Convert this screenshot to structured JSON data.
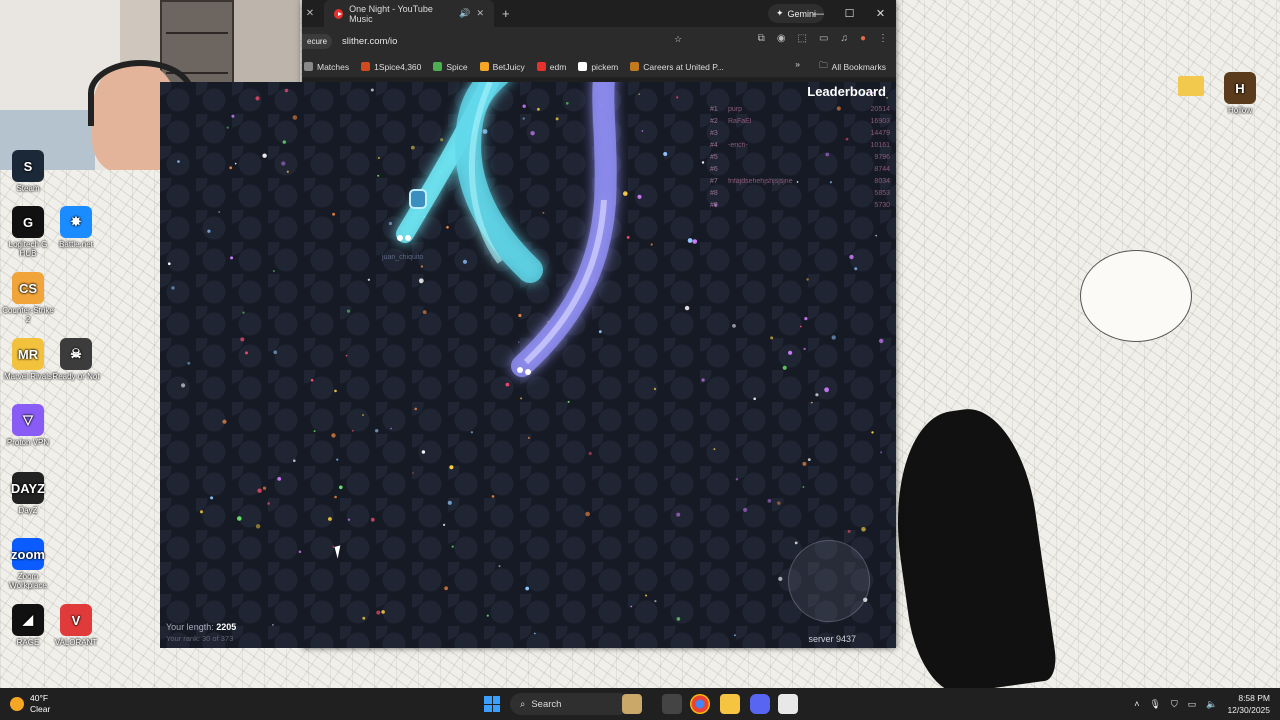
{
  "webcam": {
    "label": ""
  },
  "desktop": {
    "icons": [
      {
        "label": "Logitech G HUB",
        "glyph": "G",
        "color": "#111111"
      },
      {
        "label": "Battle.net",
        "glyph": "✸",
        "color": "#1a8cff"
      },
      {
        "label": "Counter-Strike 2",
        "glyph": "CS",
        "color": "#f0a43a"
      },
      {
        "label": "Marvel Rivals",
        "glyph": "MR",
        "color": "#f3c23c"
      },
      {
        "label": "Ready or Not",
        "glyph": "☠",
        "color": "#3c3c3c"
      },
      {
        "label": "Proton VPN",
        "glyph": "▽",
        "color": "#8a5cf6"
      },
      {
        "label": "DayZ",
        "glyph": "DAYZ",
        "color": "#222222"
      },
      {
        "label": "Zoom Workplace",
        "glyph": "zoom",
        "color": "#0b5cff"
      },
      {
        "label": "RAGE",
        "glyph": "◢",
        "color": "#111111"
      },
      {
        "label": "VALORANT",
        "glyph": "V",
        "color": "#e03a3a"
      },
      {
        "label": "Steam",
        "glyph": "S",
        "color": "#1b2838"
      },
      {
        "label": "Hollow",
        "glyph": "H",
        "color": "#5a3b1c"
      }
    ]
  },
  "browser": {
    "tab_title": "One Night - YouTube Music",
    "new_tab": "+",
    "gemini_label": "Gemini",
    "window_controls": {
      "minimize": "—",
      "maximize": "☐",
      "close": "✕"
    },
    "secure_label": "ecure",
    "url": "slither.com/io",
    "bookmarks": [
      {
        "label": "Matches",
        "color": "#888888"
      },
      {
        "label": "1Spice4,360",
        "color": "#d14a1d"
      },
      {
        "label": "Spice",
        "color": "#4caf50"
      },
      {
        "label": "BetJuicy",
        "color": "#f5a623"
      },
      {
        "label": "edm",
        "color": "#e5322d"
      },
      {
        "label": "pickem",
        "color": "#ffffff"
      },
      {
        "label": "Careers at United P...",
        "color": "#c27a1e"
      }
    ],
    "bookmarks_overflow": "»",
    "all_bookmarks": "All Bookmarks"
  },
  "game": {
    "leaderboard_title": "Leaderboard",
    "leaderboard": [
      {
        "rank": "#1",
        "name": "purp",
        "score": "20514"
      },
      {
        "rank": "#2",
        "name": "RaFaEl",
        "score": "16903"
      },
      {
        "rank": "#3",
        "name": "",
        "score": "14479"
      },
      {
        "rank": "#4",
        "name": "-erich-",
        "score": "10161"
      },
      {
        "rank": "#5",
        "name": "",
        "score": "9796"
      },
      {
        "rank": "#6",
        "name": "",
        "score": "8744"
      },
      {
        "rank": "#7",
        "name": "fnfajdsehehjshjsjsjne",
        "score": "8034"
      },
      {
        "rank": "#8",
        "name": "",
        "score": "5853"
      },
      {
        "rank": "#9",
        "name": "",
        "score": "5730"
      }
    ],
    "snake_name": "juan_chiquito",
    "length_label": "Your length:",
    "length_value": "2205",
    "rank_text": "Your rank: 30 of 373",
    "server": "server 9437"
  },
  "taskbar": {
    "temperature": "40°F",
    "condition": "Clear",
    "search_label": "Search",
    "time": "8:58 PM",
    "date": "12/30/2025"
  }
}
